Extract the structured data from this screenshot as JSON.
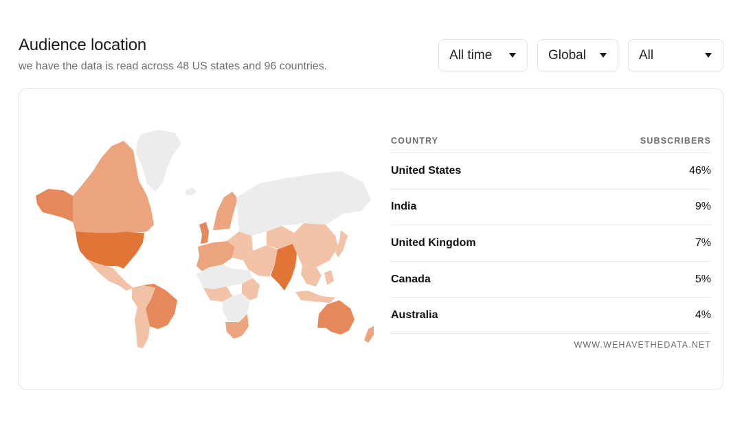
{
  "header": {
    "title": "Audience location",
    "subtitle": "we have the data is read across 48 US states and 96 countries."
  },
  "filters": {
    "time": "All time",
    "region": "Global",
    "type": "All"
  },
  "table": {
    "col_country": "COUNTRY",
    "col_subscribers": "SUBSCRIBERS",
    "rows": [
      {
        "country": "United States",
        "value": "46%"
      },
      {
        "country": "India",
        "value": "9%"
      },
      {
        "country": "United Kingdom",
        "value": "7%"
      },
      {
        "country": "Canada",
        "value": "5%"
      },
      {
        "country": "Australia",
        "value": "4%"
      }
    ],
    "footer": "WWW.WEHAVETHEDATA.NET"
  },
  "colors": {
    "no_data": "#ececec",
    "level_1": "#f2c2a6",
    "level_2": "#eba47e",
    "level_3": "#e6895a",
    "level_4": "#e27535",
    "border": "#e6e6e6"
  }
}
